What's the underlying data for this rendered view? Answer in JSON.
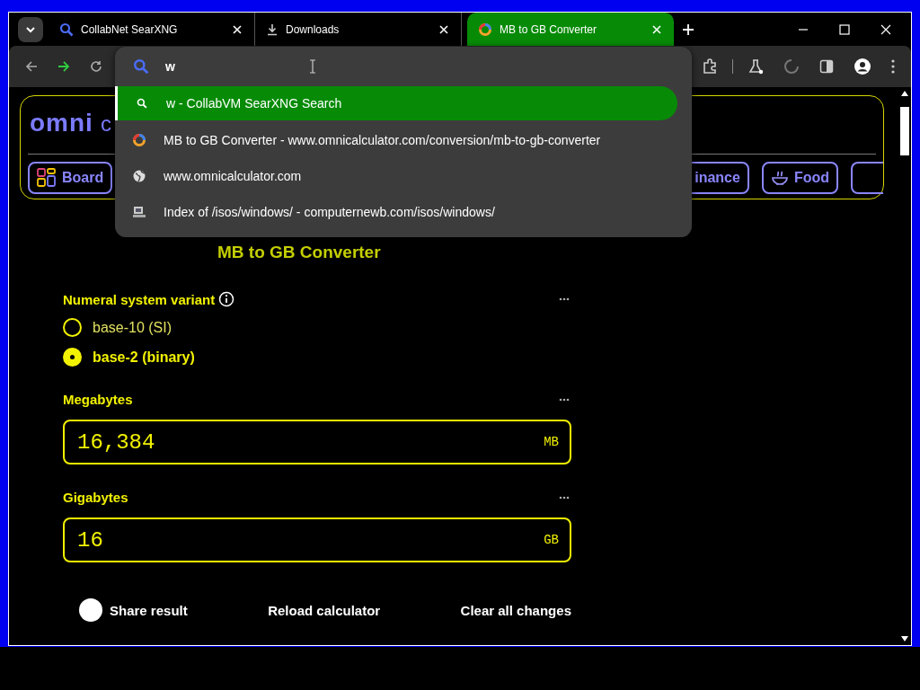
{
  "tabs": [
    {
      "title": "CollabNet SearXNG",
      "kind": "search",
      "selected": false
    },
    {
      "title": "Downloads",
      "kind": "download",
      "selected": false
    },
    {
      "title": "MB to GB Converter",
      "kind": "site",
      "selected": true
    }
  ],
  "omnibox": {
    "value": "w",
    "suggestions": [
      {
        "text": "w - CollabVM SearXNG Search",
        "kind": "search",
        "selected": true
      },
      {
        "text": "MB to GB Converter - www.omnicalculator.com/conversion/mb-to-gb-converter",
        "kind": "site",
        "selected": false
      },
      {
        "text": "www.omnicalculator.com",
        "kind": "globe",
        "selected": false
      },
      {
        "text": "Index of /isos/windows/ - computernewb.com/isos/windows/",
        "kind": "server",
        "selected": false
      }
    ]
  },
  "page": {
    "logo": "omni",
    "logo_tail": "c",
    "nav": [
      {
        "label": "Board",
        "kind": "board"
      },
      {
        "label": "inance",
        "kind": "none"
      },
      {
        "label": "Food",
        "kind": "food"
      }
    ],
    "title": "MB to GB Converter",
    "variant_label": "Numeral system variant",
    "variants": [
      {
        "label": "base-10 (SI)",
        "selected": false
      },
      {
        "label": "base-2 (binary)",
        "selected": true
      }
    ],
    "fields": [
      {
        "label": "Megabytes",
        "value": "16,384",
        "unit": "MB"
      },
      {
        "label": "Gigabytes",
        "value": "16",
        "unit": "GB"
      }
    ],
    "actions": [
      "Share result",
      "Reload calculator",
      "Clear all changes"
    ]
  }
}
